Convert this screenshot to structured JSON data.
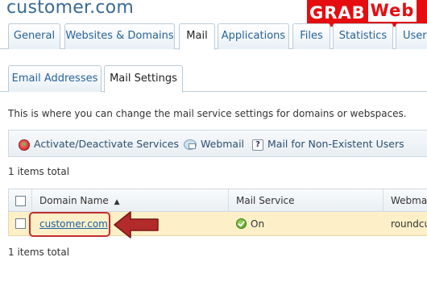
{
  "page": {
    "title": "customer.com"
  },
  "watermark": {
    "part1": "GRAB",
    "part2": "Web"
  },
  "top_tabs": [
    {
      "label": "General",
      "active": false
    },
    {
      "label": "Websites & Domains",
      "active": false
    },
    {
      "label": "Mail",
      "active": true
    },
    {
      "label": "Applications",
      "active": false
    },
    {
      "label": "Files",
      "active": false
    },
    {
      "label": "Statistics",
      "active": false
    },
    {
      "label": "Users",
      "active": false
    }
  ],
  "sub_tabs": [
    {
      "label": "Email Addresses",
      "active": false
    },
    {
      "label": "Mail Settings",
      "active": true
    }
  ],
  "description": "This is where you can change the mail service settings for domains or webspaces.",
  "toolbar": {
    "activate": {
      "label": "Activate/Deactivate Services",
      "icon": "power-icon"
    },
    "webmail": {
      "label": "Webmail",
      "icon": "webmail-icon"
    },
    "non_existent": {
      "label": "Mail for Non-Existent Users",
      "icon": "help-icon"
    }
  },
  "items_total_top": "1 items total",
  "items_total_bottom": "1 items total",
  "table": {
    "columns": [
      {
        "label": "Domain Name",
        "sort": "ascending"
      },
      {
        "label": "Mail Service"
      },
      {
        "label": "Webmail"
      }
    ],
    "rows": [
      {
        "domain": "customer.com",
        "mail_service": "On",
        "webmail": "roundcube"
      }
    ]
  },
  "colors": {
    "accent_blue": "#3a6a95",
    "link_blue": "#1b5fa0",
    "row_highlight": "#fdf0c8",
    "annotation_red": "#c23030",
    "watermark_red": "#e50d10"
  },
  "icons": {
    "sort": "▲"
  }
}
